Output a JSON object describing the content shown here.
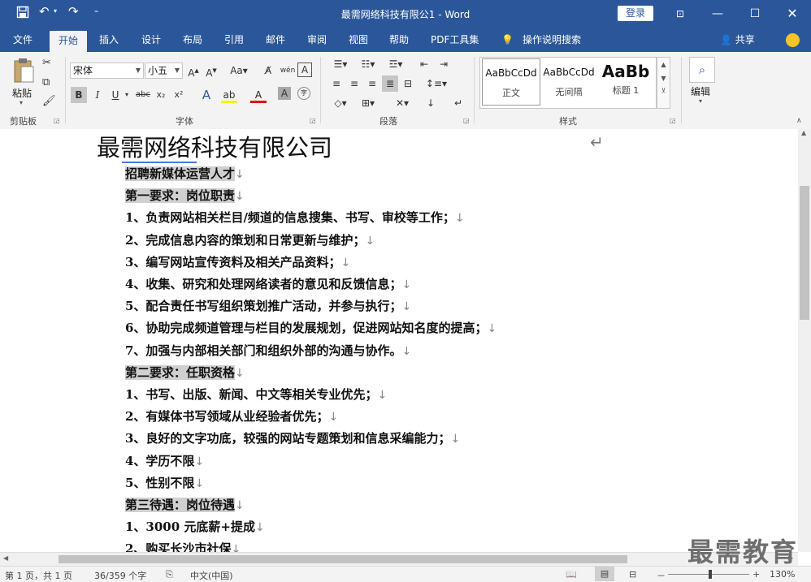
{
  "titlebar": {
    "title": "最需网络科技有限公1  -  Word",
    "login_label": "登录",
    "save_icon": "save-icon",
    "undo_icon": "undo-icon",
    "redo_icon": "redo-icon",
    "customize_icon": "customize-quick-access-icon"
  },
  "tabs": [
    {
      "label": "文件"
    },
    {
      "label": "开始"
    },
    {
      "label": "插入"
    },
    {
      "label": "设计"
    },
    {
      "label": "布局"
    },
    {
      "label": "引用"
    },
    {
      "label": "邮件"
    },
    {
      "label": "审阅"
    },
    {
      "label": "视图"
    },
    {
      "label": "帮助"
    },
    {
      "label": "PDF工具集"
    },
    {
      "label": "操作说明搜索"
    }
  ],
  "share_label": "共享",
  "ribbon": {
    "clipboard": {
      "paste_label": "粘贴",
      "group_label": "剪贴板"
    },
    "font": {
      "font_name": "宋体",
      "font_size": "小五",
      "group_label": "字体"
    },
    "paragraph": {
      "group_label": "段落"
    },
    "styles": {
      "group_label": "样式",
      "items": [
        {
          "preview": "AaBbCcDd",
          "name": "正文"
        },
        {
          "preview": "AaBbCcDd",
          "name": "无间隔"
        },
        {
          "preview": "AaBb",
          "name": "标题 1"
        }
      ]
    },
    "editing": {
      "label": "编辑"
    }
  },
  "document": {
    "heading": "最需网络科技有限公司",
    "lines": [
      {
        "text": "招聘新媒体运营人才",
        "hl": true
      },
      {
        "text": "第一要求：岗位职责",
        "hl": true
      },
      {
        "text": "1、负责网站相关栏目/频道的信息搜集、书写、审校等工作；",
        "hl": false
      },
      {
        "text": "2、完成信息内容的策划和日常更新与维护；",
        "hl": false
      },
      {
        "text": "3、编写网站宣传资料及相关产品资料；",
        "hl": false
      },
      {
        "text": "4、收集、研究和处理网络读者的意见和反馈信息；",
        "hl": false
      },
      {
        "text": "5、配合责任书写组织策划推广活动，并参与执行；",
        "hl": false
      },
      {
        "text": "6、协助完成频道管理与栏目的发展规划，促进网站知名度的提高；",
        "hl": false
      },
      {
        "text": "7、加强与内部相关部门和组织外部的沟通与协作。",
        "hl": false
      },
      {
        "text": "第二要求：任职资格",
        "hl": true
      },
      {
        "text": "1、书写、出版、新闻、中文等相关专业优先；",
        "hl": false
      },
      {
        "text": "2、有媒体书写领域从业经验者优先；",
        "hl": false
      },
      {
        "text": "3、良好的文字功底，较强的网站专题策划和信息采编能力；",
        "hl": false
      },
      {
        "text": "4、学历不限",
        "hl": false
      },
      {
        "text": "5、性别不限",
        "hl": false
      },
      {
        "text": "第三待遇：岗位待遇",
        "hl": true
      },
      {
        "text": "1、3000 元底薪+提成",
        "hl": false
      },
      {
        "text": "2、购买长沙市社保",
        "hl": false
      }
    ],
    "paragraph_mark": "↓"
  },
  "watermark": "最需教育",
  "status": {
    "page": "第 1 页，共 1 页",
    "words": "36/359 个字",
    "language": "中文(中国)",
    "zoom": "130%",
    "zoom_minus": "－",
    "zoom_plus": "+"
  }
}
